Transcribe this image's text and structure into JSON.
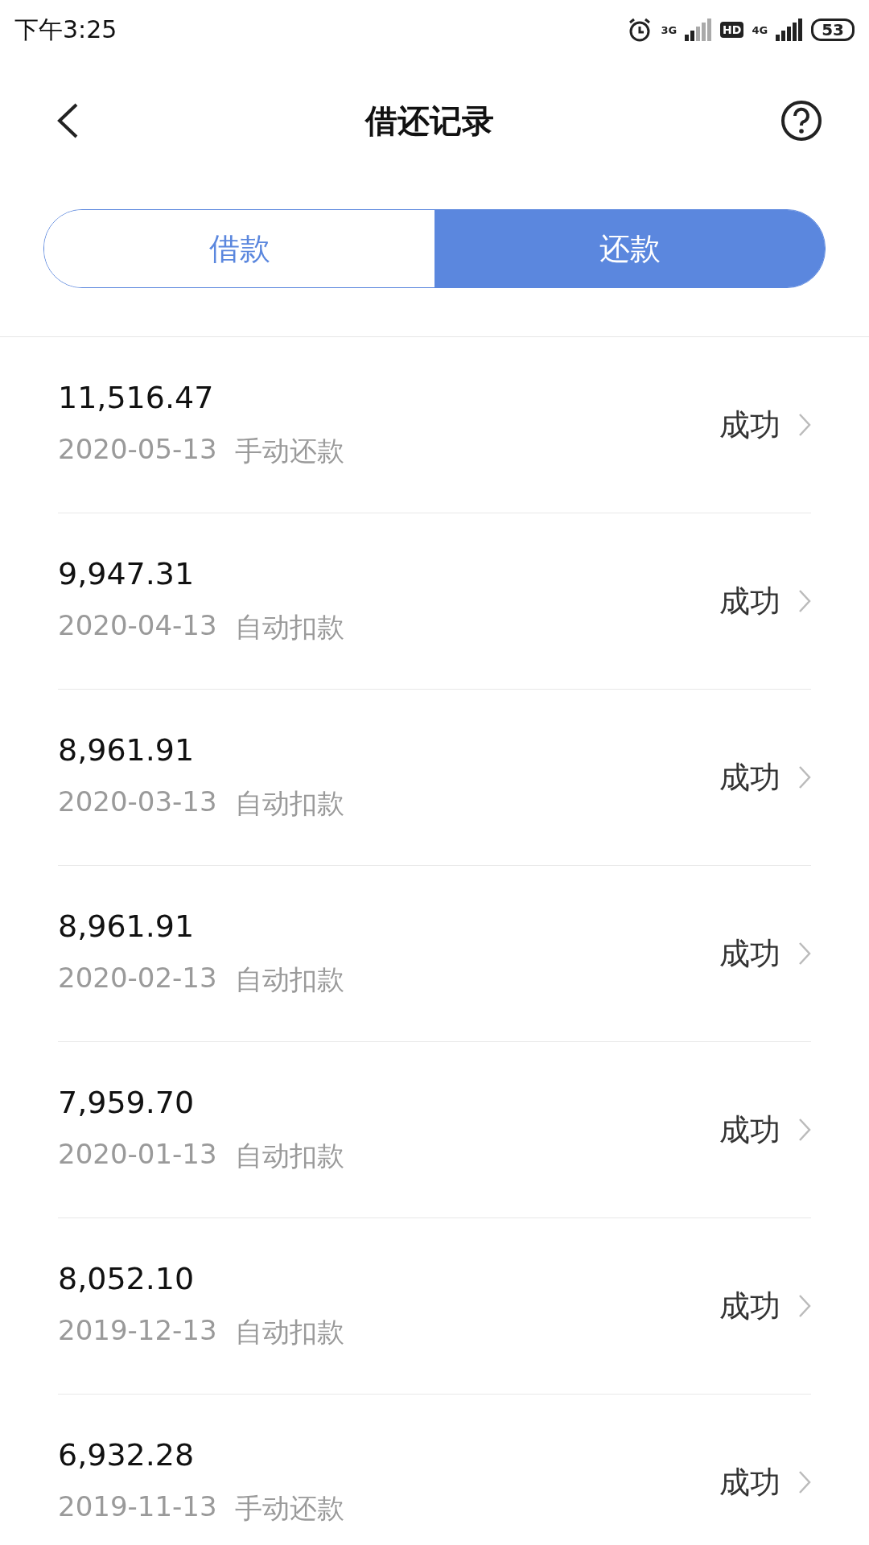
{
  "status_bar": {
    "time": "下午3:25",
    "net1": "3G",
    "hd": "HD",
    "net2": "4G",
    "battery": "53"
  },
  "header": {
    "title": "借还记录"
  },
  "tabs": [
    {
      "label": "借款",
      "selected": false
    },
    {
      "label": "还款",
      "selected": true
    }
  ],
  "records": [
    {
      "amount": "11,516.47",
      "date": "2020-05-13",
      "type": "手动还款",
      "status": "成功"
    },
    {
      "amount": "9,947.31",
      "date": "2020-04-13",
      "type": "自动扣款",
      "status": "成功"
    },
    {
      "amount": "8,961.91",
      "date": "2020-03-13",
      "type": "自动扣款",
      "status": "成功"
    },
    {
      "amount": "8,961.91",
      "date": "2020-02-13",
      "type": "自动扣款",
      "status": "成功"
    },
    {
      "amount": "7,959.70",
      "date": "2020-01-13",
      "type": "自动扣款",
      "status": "成功"
    },
    {
      "amount": "8,052.10",
      "date": "2019-12-13",
      "type": "自动扣款",
      "status": "成功"
    },
    {
      "amount": "6,932.28",
      "date": "2019-11-13",
      "type": "手动还款",
      "status": "成功"
    }
  ]
}
